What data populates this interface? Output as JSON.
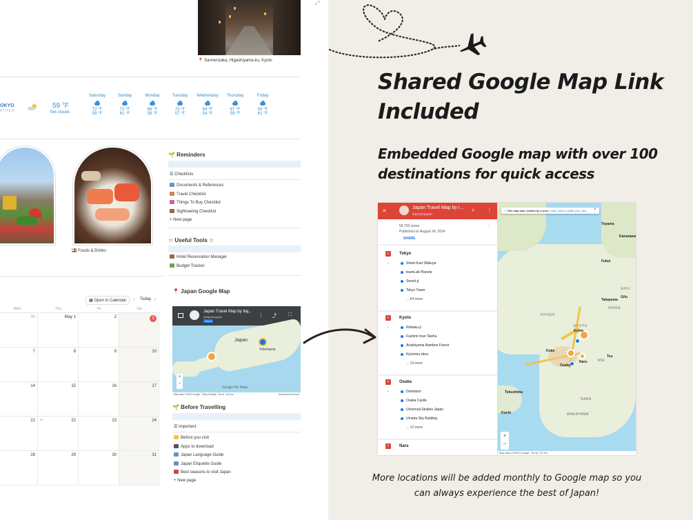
{
  "street_caption": "📍 Sannenzaka, Higashiyama-ku, Kyoto",
  "weather": {
    "city": "OKYO",
    "city_sub": "ATHER",
    "current_temp": "59 °F",
    "current_desc": "few clouds",
    "days": [
      {
        "name": "Saturday",
        "hi": "72 °F",
        "lo": "59 °F"
      },
      {
        "name": "Sunday",
        "hi": "72 °F",
        "lo": "61 °F"
      },
      {
        "name": "Monday",
        "hi": "66 °F",
        "lo": "56 °F"
      },
      {
        "name": "Tuesday",
        "hi": "73 °F",
        "lo": "57 °F"
      },
      {
        "name": "Wednesday",
        "hi": "64 °F",
        "lo": "54 °F"
      },
      {
        "name": "Thursday",
        "hi": "67 °F",
        "lo": "59 °F"
      },
      {
        "name": "Friday",
        "hi": "63 °F",
        "lo": "61 °F"
      }
    ]
  },
  "foods_caption": "🍱 Foods & Drinks",
  "reminders": {
    "title": "🌱 Reminders",
    "list_label": "☰ Checklists",
    "items": [
      "Documents & References",
      "Travel Checklist",
      "Things To Buy Checklist",
      "Sightseeing Checklist"
    ],
    "new_page": "+ New page"
  },
  "tools": {
    "title": "☆ Useful Tools ☆",
    "items": [
      "Hotel Reservation Manager",
      "Budget Tracker"
    ]
  },
  "calendar": {
    "open_label": "Open in Calendar",
    "today_label": "Today",
    "weekdays": [
      "Wed",
      "Thu",
      "Fri",
      "Sat"
    ],
    "rows": [
      [
        "30",
        "May 1",
        "2",
        "3"
      ],
      [
        "7",
        "8",
        "9",
        "10"
      ],
      [
        "14",
        "15",
        "16",
        "17"
      ],
      [
        "21",
        "22",
        "23",
        "24"
      ],
      [
        "28",
        "29",
        "30",
        "31"
      ]
    ]
  },
  "japan_map": {
    "title": "📍 Japan Google Map",
    "header_title": "Japan Travel Map by itaj...",
    "header_sub": "@itajustinjapan",
    "about": "About",
    "label_japan": "Japan",
    "label_yokohama": "Yokohama",
    "footer_left": "Map data ©2025 Google, TMap Mobility",
    "footer_terms": "Terms",
    "footer_scale": "100 km",
    "footer_right": "Keyboard shortcuts",
    "google_mark": "Google My Maps"
  },
  "before": {
    "title": "🌱 Before Travelling",
    "list_label": "☰ Important",
    "items": [
      "Before you visit",
      "Apps to download",
      "Japan Language Guide",
      "Japan Etiquette Guide",
      "Best seasons to visit Japan"
    ],
    "new_page": "+ New page"
  },
  "headline": {
    "line1": "Shared Google Map Link",
    "line2": "Included",
    "sub1": "Embedded Google map with over 100",
    "sub2": "destinations for quick access"
  },
  "maps_panel": {
    "title": "Japan Travel Map by i...",
    "sub": "itajustinjapan",
    "views": "59,703 views",
    "published": "Published on August 24, 2024",
    "share": "SHARE",
    "notice": "This map was created by a user.",
    "notice_link": "Learn how to create your own.",
    "sections": [
      {
        "name": "Tokyo",
        "items": [
          "Street Kart Shibuya",
          "teamLab Planets",
          "Sensō-ji",
          "Tokyo Tower"
        ],
        "more": "... 64 more"
      },
      {
        "name": "Kyoto",
        "items": [
          "Kinkaku-ji",
          "Fushimi Inari Taisha",
          "Arashiyama Bamboo Forest",
          "Kiyomizu-dera"
        ],
        "more": "... 19 more"
      },
      {
        "name": "Osaka",
        "items": [
          "Dotonbori",
          "Osaka Castle",
          "Universal Studios Japan",
          "Umeda Sky Building"
        ],
        "more": "... 12 more"
      },
      {
        "name": "Nara",
        "items": [],
        "more": ""
      }
    ],
    "map_labels": [
      "Kanazawa",
      "Toyama",
      "Fukui",
      "KYOTO",
      "Kyoto",
      "Kobe",
      "Osaka",
      "Nara",
      "MIE",
      "SHIGA",
      "NARA",
      "WAKAYAMA",
      "HYOGO",
      "Tsu",
      "Gifu",
      "GIFU",
      "Takayama",
      "Tokushima",
      "Kochi"
    ],
    "footer": "Map data ©2025 Google",
    "footer_terms": "Terms",
    "footer_scale": "20 km"
  },
  "bottom_note": {
    "line1": "More locations will be added monthly to Google map so you",
    "line2": "can always experience the best of Japan!"
  },
  "colors": {
    "accent_red": "#db4437",
    "map_water": "#a7d8ee",
    "link_blue": "#1a73e8"
  }
}
